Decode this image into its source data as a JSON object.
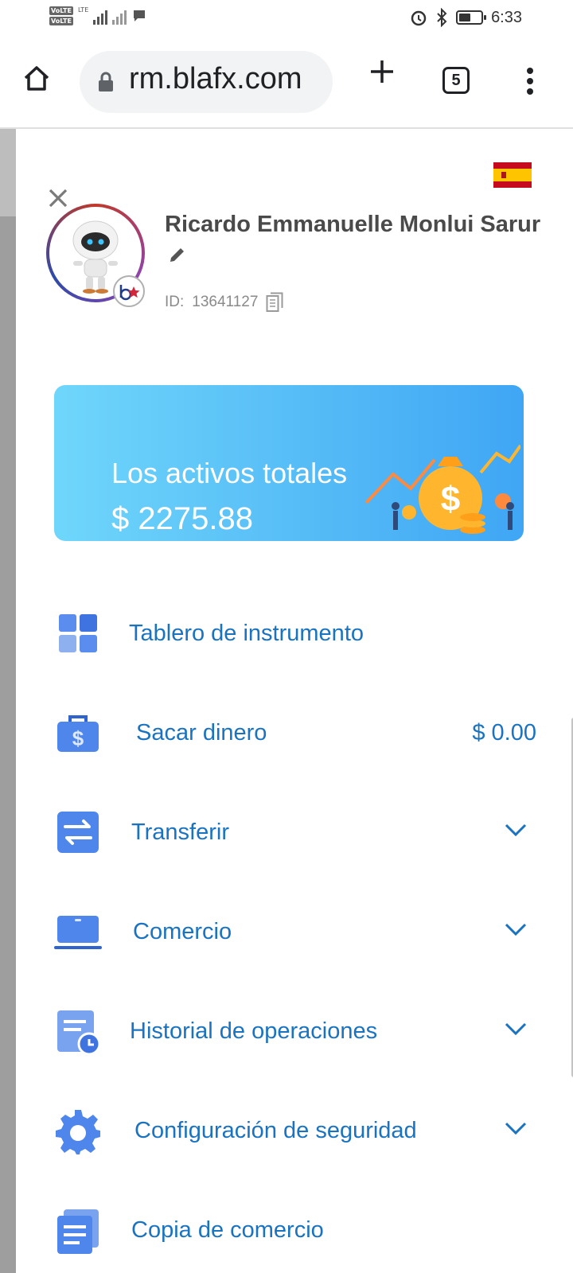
{
  "status": {
    "time": "6:33",
    "volte1": "VoLTE",
    "volte2": "VoLTE",
    "network": "LTE"
  },
  "browser": {
    "url": "rm.blafx.com",
    "tab_count": "5"
  },
  "profile": {
    "name": "Ricardo Emmanuelle Monlui Sarur",
    "id_label": "ID:",
    "id_value": "13641127"
  },
  "assets_card": {
    "title": "Los activos totales",
    "amount": "$ 2275.88"
  },
  "menu": [
    {
      "label": "Tablero de instrumento",
      "icon": "dashboard-icon"
    },
    {
      "label": "Sacar dinero",
      "value": "$ 0.00",
      "icon": "wallet-icon"
    },
    {
      "label": "Transferir",
      "icon": "transfer-icon"
    },
    {
      "label": "Comercio",
      "icon": "laptop-icon"
    },
    {
      "label": "Historial de operaciones",
      "icon": "history-icon"
    },
    {
      "label": "Configuración de seguridad",
      "icon": "gear-icon"
    },
    {
      "label": "Copia de comercio",
      "icon": "copy-trade-icon"
    }
  ],
  "colors": {
    "accent": "#1a73c1",
    "card_start": "#6fd6fb",
    "card_end": "#3fa6f5"
  }
}
